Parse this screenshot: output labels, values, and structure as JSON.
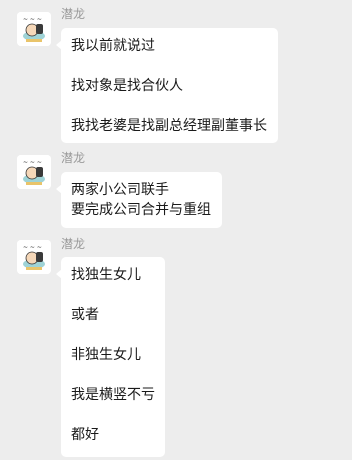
{
  "messages": [
    {
      "sender": "潜龙",
      "avatar_icon": "cartoon-character-avatar",
      "lines": [
        "我以前就说过",
        "",
        "找对象是找合伙人",
        "",
        "我找老婆是找副总经理副董事长"
      ]
    },
    {
      "sender": "潜龙",
      "avatar_icon": "cartoon-character-avatar",
      "lines": [
        "两家小公司联手",
        "要完成公司合并与重组"
      ]
    },
    {
      "sender": "潜龙",
      "avatar_icon": "cartoon-character-avatar",
      "lines": [
        "找独生女儿",
        "",
        "或者",
        "",
        "非独生女儿",
        "",
        "我是横竖不亏",
        "",
        "都好"
      ]
    }
  ],
  "colors": {
    "background": "#ededed",
    "bubble": "#ffffff",
    "sender_name": "#9a9a9a",
    "message_text": "#1a1a1a"
  }
}
